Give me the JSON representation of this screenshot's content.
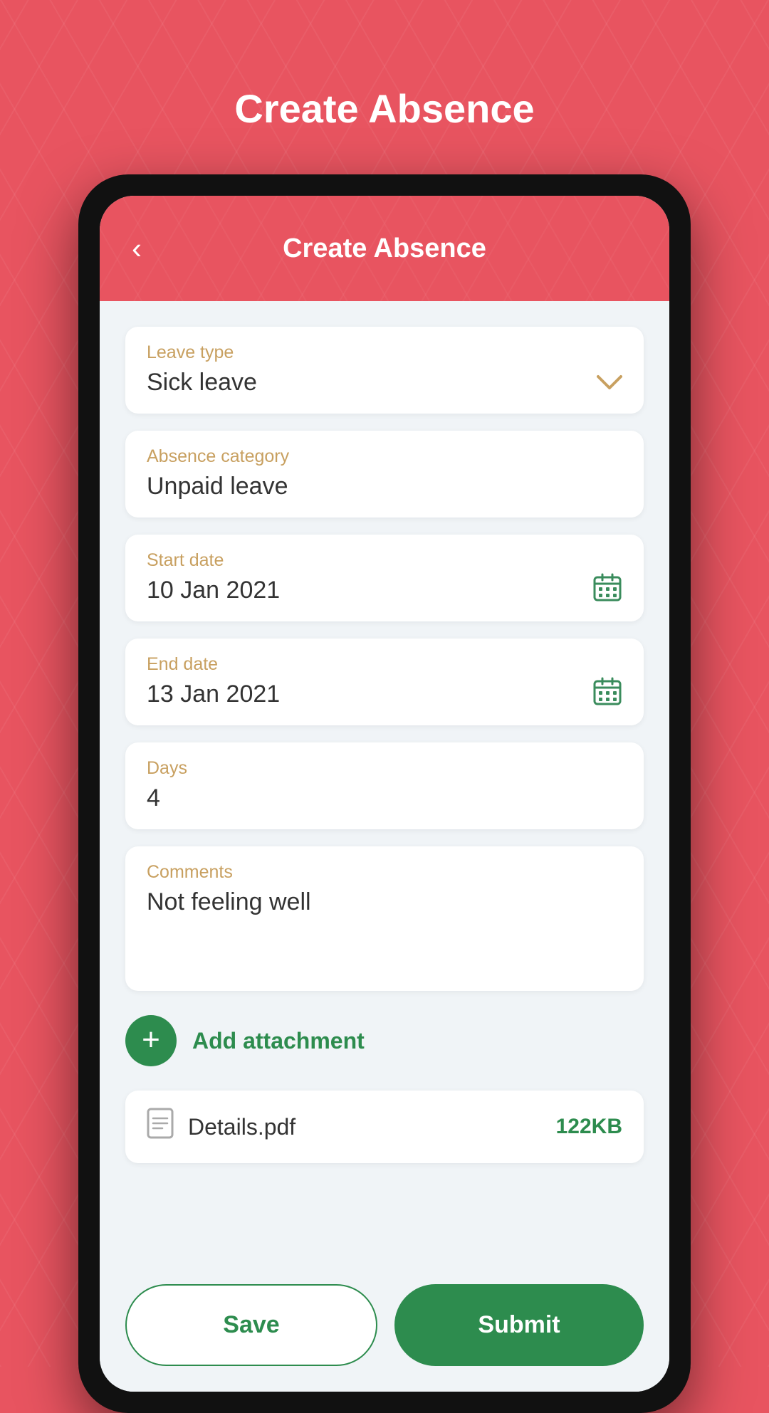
{
  "page": {
    "title": "Create Absence",
    "back_button": "‹"
  },
  "header": {
    "title": "Create Absence"
  },
  "form": {
    "leave_type": {
      "label": "Leave type",
      "value": "Sick leave"
    },
    "absence_category": {
      "label": "Absence category",
      "value": "Unpaid leave"
    },
    "start_date": {
      "label": "Start date",
      "value": "10 Jan 2021"
    },
    "end_date": {
      "label": "End date",
      "value": "13 Jan 2021"
    },
    "days": {
      "label": "Days",
      "value": "4"
    },
    "comments": {
      "label": "Comments",
      "value": "Not feeling well"
    }
  },
  "attachment": {
    "add_label": "Add attachment",
    "file_name": "Details.pdf",
    "file_size": "122KB"
  },
  "buttons": {
    "save": "Save",
    "submit": "Submit"
  },
  "icons": {
    "plus": "+",
    "chevron_down": "⌄",
    "back": "‹",
    "file": "📄"
  }
}
